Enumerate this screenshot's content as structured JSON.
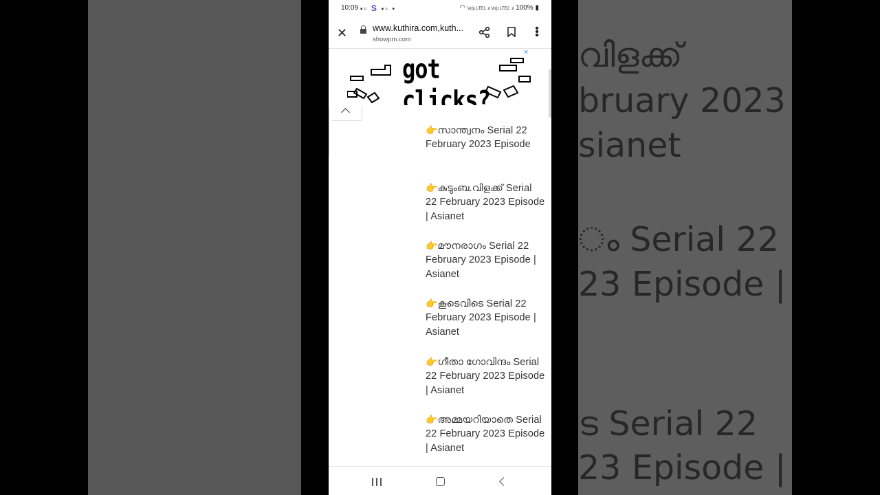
{
  "status_bar": {
    "time": "10:09",
    "battery": "100%",
    "signal_text": "Vo)) LTE1 .ıl Vo)) LTE2 .ıl"
  },
  "browser": {
    "url": "www.kuthira.com,kuth...",
    "subtitle": "showpm.com"
  },
  "ad": {
    "text": "got clicks?",
    "close_label": "×"
  },
  "items": [
    {
      "finger": "👉",
      "text": "സാന്ത്വനം Serial 22 February 2023 Episode"
    },
    {
      "finger": "👉",
      "text": "കുടുംബ.വിളക്ക് Serial 22 February 2023 Episode | Asianet"
    },
    {
      "finger": "👉",
      "text": "മൗനരാഗം Serial 22 February 2023 Episode | Asianet"
    },
    {
      "finger": "👉",
      "text": "കൂടെവിടെ Serial 22 February 2023 Episode | Asianet"
    },
    {
      "finger": "👉",
      "text": "ഗീതാ ഗോവിന്ദം Serial 22 February 2023 Episode | Asianet"
    },
    {
      "finger": "👉",
      "text": "അമ്മയറിയാതെ Serial 22 February 2023 Episode | Asianet"
    }
  ],
  "background_blur": {
    "right_lines": [
      "വിളക്ക്",
      "bruary 2023",
      "sianet",
      "ം Serial 22",
      "23 Episode |",
      "ട Serial 22",
      "23 Episode |"
    ]
  }
}
